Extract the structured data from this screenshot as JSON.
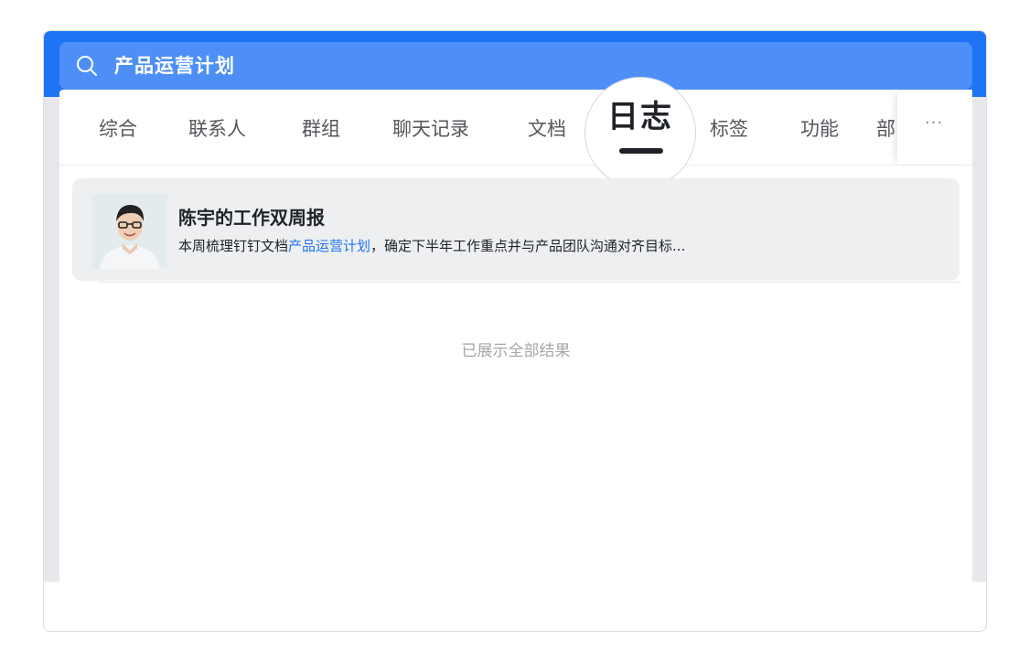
{
  "search": {
    "query": "产品运营计划"
  },
  "tabs": [
    {
      "label": "综合"
    },
    {
      "label": "联系人"
    },
    {
      "label": "群组"
    },
    {
      "label": "聊天记录"
    },
    {
      "label": "文档"
    },
    {
      "label": "日志"
    },
    {
      "label": "标签"
    },
    {
      "label": "功能"
    },
    {
      "label": "部"
    }
  ],
  "active_tab": "日志",
  "more_label": "···",
  "result": {
    "title": "陈宇的工作双周报",
    "snippet_before": "本周梳理钉钉文档",
    "snippet_highlight": "产品运营计划",
    "snippet_after": "，确定下半年工作重点并与产品团队沟通对齐目标..."
  },
  "end_message": "已展示全部结果",
  "colors": {
    "brand_blue": "#1f74f3",
    "highlight": "#1f74f3"
  }
}
